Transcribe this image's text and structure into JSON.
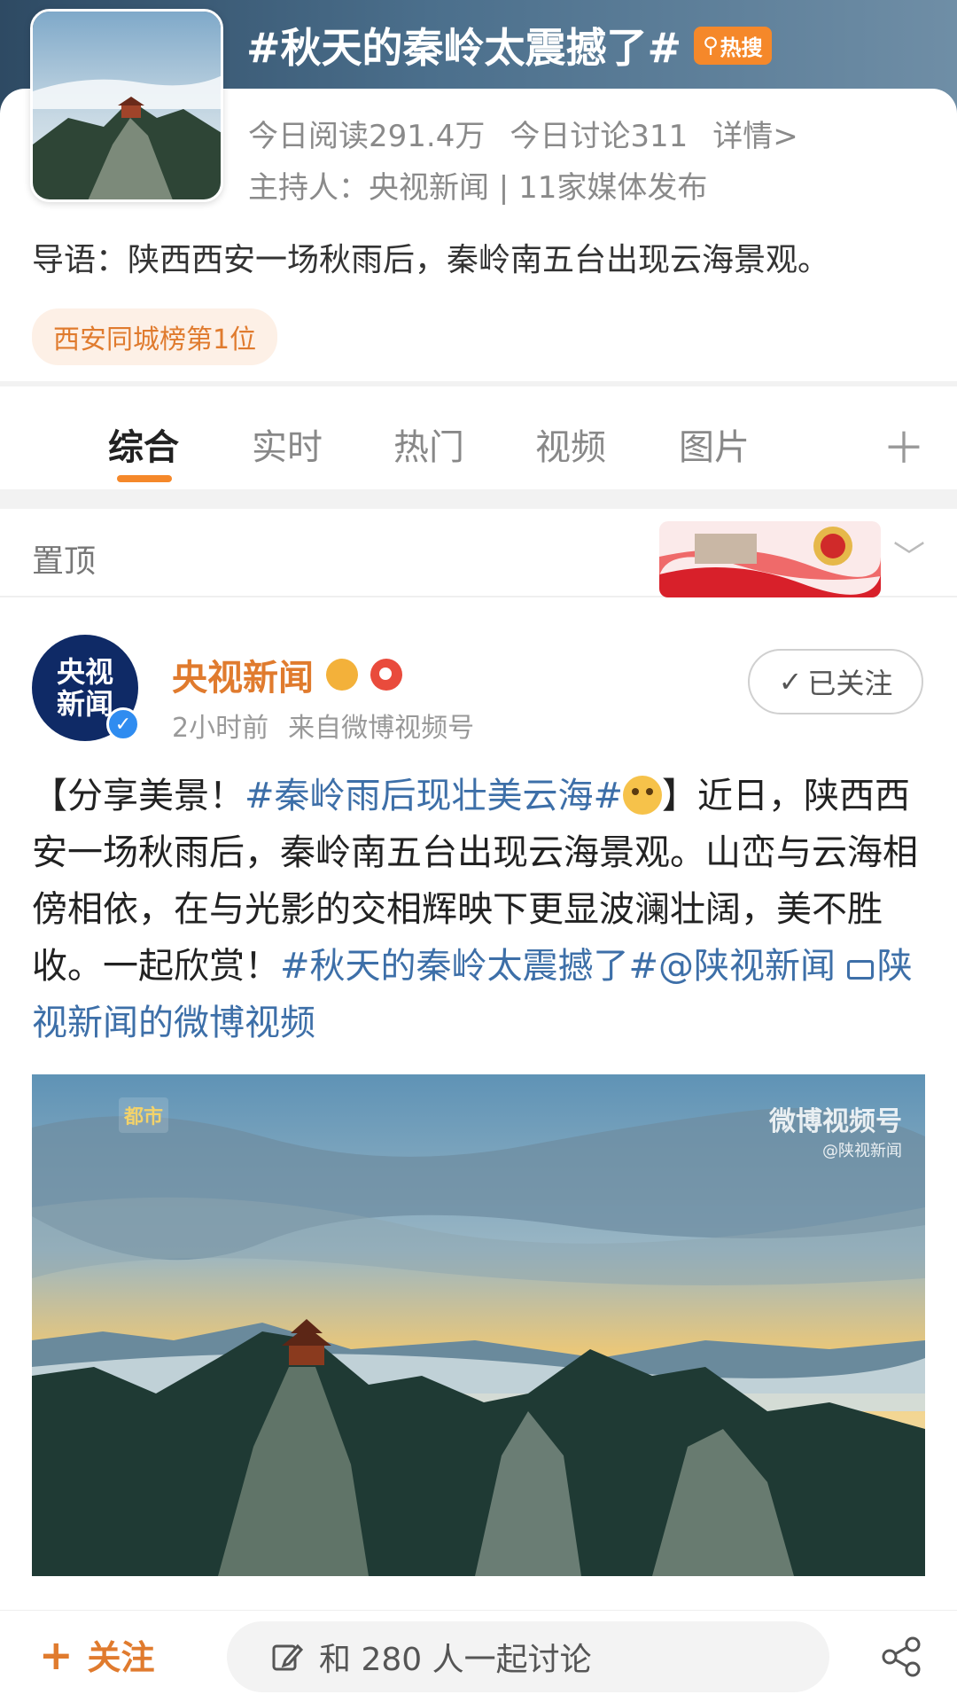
{
  "topic": {
    "title": "#秋天的秦岭太震撼了#",
    "hot_badge": "热搜",
    "read_today": "今日阅读291.4万",
    "discuss_today": "今日讨论311",
    "details_link": "详情>",
    "host": "主持人：央视新闻 | 11家媒体发布",
    "intro": "导语：陕西西安一场秋雨后，秦岭南五台出现云海景观。",
    "rank_chip": "西安同城榜第1位"
  },
  "tabs": [
    {
      "label": "综合",
      "active": true
    },
    {
      "label": "实时",
      "active": false
    },
    {
      "label": "热门",
      "active": false
    },
    {
      "label": "视频",
      "active": false
    },
    {
      "label": "图片",
      "active": false
    }
  ],
  "tab_add_icon": "plus-icon",
  "pinned": {
    "label": "置顶",
    "chevron_icon": "chevron-down-icon"
  },
  "post": {
    "author": "央视新闻",
    "avatar_text": [
      "央视",
      "新闻"
    ],
    "time": "2小时前",
    "source": "来自微博视频号",
    "follow_label": "已关注",
    "text_lead": "【分享美景！",
    "tag1": "#秦岭雨后现壮美云海#",
    "text_mid": "】近日，陕西西安一场秋雨后，秦岭南五台出现云海景观。山峦与云海相傍相依，在与光影的交相辉映下更显波澜壮阔，美不胜收。一起欣赏！",
    "tag2": "#秋天的秦岭太震撼了#",
    "mention": "@陕视新闻",
    "video_link": "陕视新闻的微博视频",
    "watermark_main": "微博视频号",
    "watermark_sub": "@陕视新闻",
    "watermark_left": "都市"
  },
  "bottom_bar": {
    "follow_label": "关注",
    "input_placeholder": "和 280 人一起讨论",
    "share_icon": "share-icon"
  },
  "colors": {
    "accent": "#e07b2e",
    "link": "#3d6fa8",
    "tab_underline": "#f5882a"
  }
}
